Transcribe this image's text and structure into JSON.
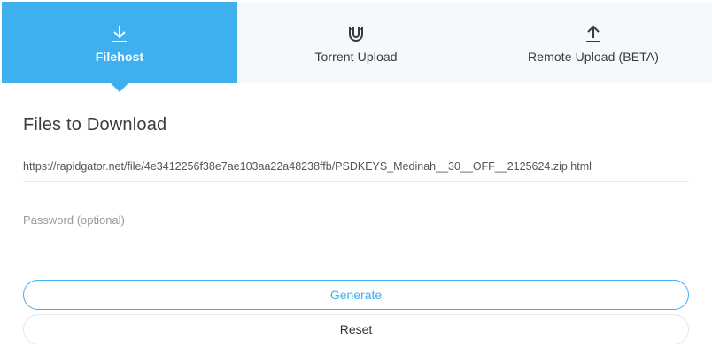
{
  "tabs": [
    {
      "label": "Filehost",
      "icon": "download-icon",
      "active": true
    },
    {
      "label": "Torrent Upload",
      "icon": "magnet-icon",
      "active": false
    },
    {
      "label": "Remote Upload (BETA)",
      "icon": "upload-icon",
      "active": false
    }
  ],
  "main": {
    "title": "Files to Download",
    "url_value": "https://rapidgator.net/file/4e3412256f38e7ae103aa22a48238ffb/PSDKEYS_Medinah__30__OFF__2125624.zip.html",
    "password_placeholder": "Password (optional)",
    "password_value": ""
  },
  "buttons": {
    "generate_label": "Generate",
    "reset_label": "Reset"
  },
  "colors": {
    "accent": "#3fb0ee",
    "tab_inactive_bg": "#f4f9fb"
  }
}
